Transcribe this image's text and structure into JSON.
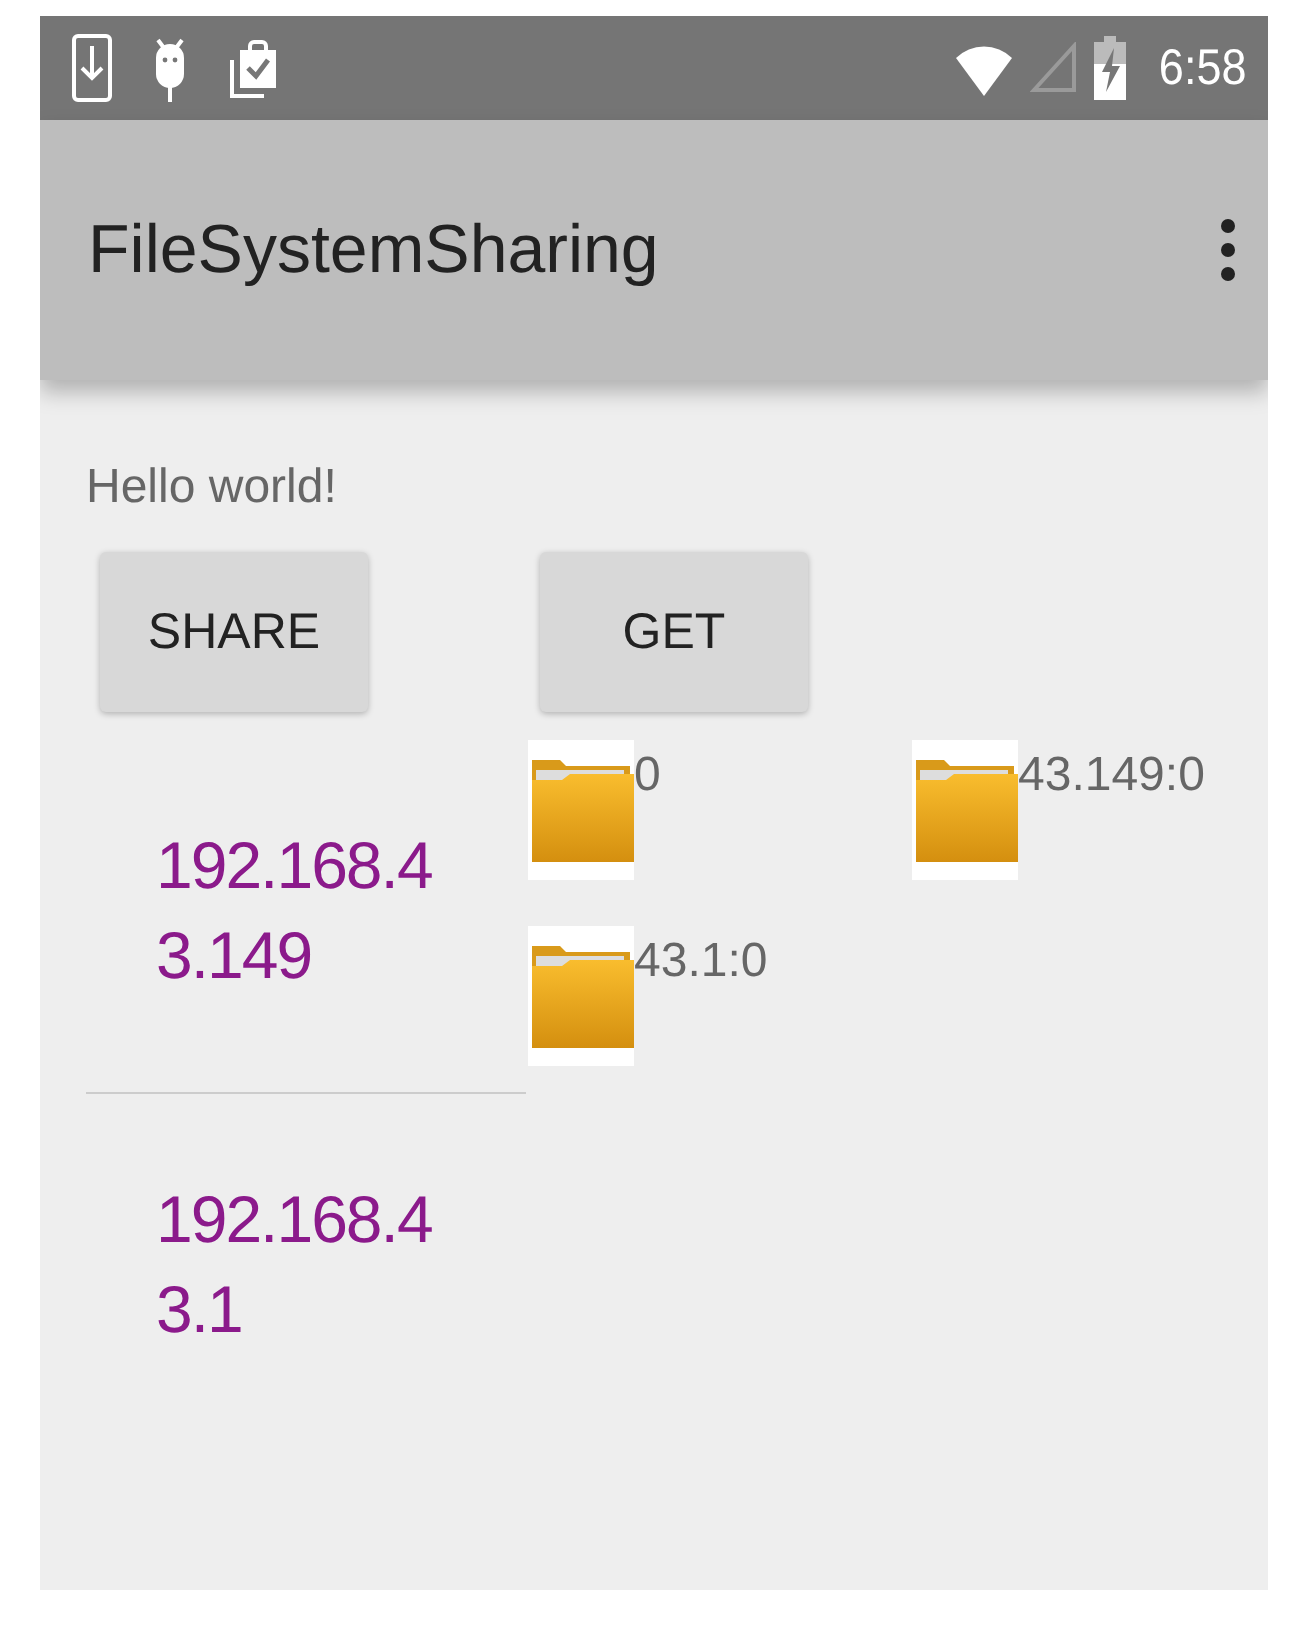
{
  "status_bar": {
    "time": "6:58"
  },
  "app_bar": {
    "title": "FileSystemSharing"
  },
  "greeting": "Hello world!",
  "buttons": [
    "SHARE",
    "GET"
  ],
  "hosts": [
    {
      "address": "192.168.43.149"
    },
    {
      "address": "192.168.43.1"
    }
  ],
  "folders": [
    {
      "label": "0"
    },
    {
      "label": "43.149:0"
    },
    {
      "label": "43.1:0"
    }
  ]
}
